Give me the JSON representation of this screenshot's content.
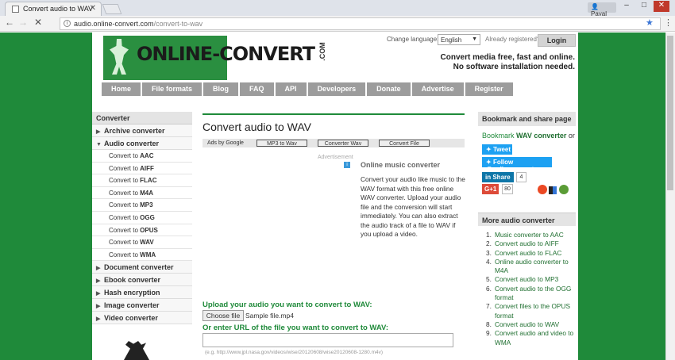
{
  "browser": {
    "tab_title": "Convert audio to WAV",
    "user_name": "Payal",
    "url_domain": "audio.online-convert.com",
    "url_path": "/convert-to-wav"
  },
  "header": {
    "logo_text": "ONLINE-CONVERT",
    "logo_suffix": ".COM",
    "change_language_label": "Change language:",
    "language": "English",
    "already_registered": "Already registered?",
    "login_label": "Login",
    "tagline1": "Convert media free, fast and online.",
    "tagline2": "No software installation needed."
  },
  "nav": [
    "Home",
    "File formats",
    "Blog",
    "FAQ",
    "API",
    "Developers",
    "Donate",
    "Advertise",
    "Register"
  ],
  "sidebar": {
    "heading": "Converter",
    "categories_top": [
      {
        "label": "Archive converter",
        "arrow": "▶"
      },
      {
        "label": "Audio converter",
        "arrow": "▼"
      }
    ],
    "audio_items": [
      {
        "prefix": "Convert to ",
        "format": "AAC"
      },
      {
        "prefix": "Convert to ",
        "format": "AIFF"
      },
      {
        "prefix": "Convert to ",
        "format": "FLAC"
      },
      {
        "prefix": "Convert to ",
        "format": "M4A"
      },
      {
        "prefix": "Convert to ",
        "format": "MP3"
      },
      {
        "prefix": "Convert to ",
        "format": "OGG"
      },
      {
        "prefix": "Convert to ",
        "format": "OPUS"
      },
      {
        "prefix": "Convert to ",
        "format": "WAV"
      },
      {
        "prefix": "Convert to ",
        "format": "WMA"
      }
    ],
    "categories_bottom": [
      {
        "label": "Document converter",
        "arrow": "▶"
      },
      {
        "label": "Ebook converter",
        "arrow": "▶"
      },
      {
        "label": "Hash encryption",
        "arrow": "▶"
      },
      {
        "label": "Image converter",
        "arrow": "▶"
      },
      {
        "label": "Video converter",
        "arrow": "▶"
      }
    ]
  },
  "main": {
    "title": "Convert audio to WAV",
    "ads_by_google": "Ads by Google",
    "ad_buttons": [
      "MP3 to Wav",
      "Converter Wav",
      "Convert File"
    ],
    "advertisement_label": "Advertisement",
    "online_music_title": "Online music converter",
    "online_music_text": "Convert your audio like music to the WAV format with this free online WAV converter. Upload your audio file and the conversion will start immediately. You can also extract the audio track of a file to WAV if you upload a video.",
    "upload_label": "Upload your audio you want to convert to WAV:",
    "choose_file_label": "Choose file",
    "file_name": "Sample file.mp4",
    "url_label": "Or enter URL of the file you want to convert to WAV:",
    "url_example": "(e.g. http://www.jpl.nasa.gov/videos/wise/20120608/wise20120608-1280.m4v)"
  },
  "right": {
    "bookmark_heading": "Bookmark and share page",
    "bookmark_prefix": "Bookmark ",
    "bookmark_bold": "WAV converter",
    "bookmark_suffix": " or",
    "tweet": "Tweet",
    "follow": "Follow @onlineconvert",
    "share": "Share",
    "share_count": "4",
    "gplus": "G+1",
    "gplus_count": "80",
    "more_heading": "More audio converter",
    "more_items": [
      "Music converter to AAC",
      "Convert audio to AIFF",
      "Convert audio to FLAC",
      "Online audio converter to M4A",
      "Convert audio to MP3",
      "Convert audio to the OGG format",
      "Convert files to the OPUS format",
      "Convert audio to WAV",
      "Convert audio and video to WMA"
    ]
  }
}
